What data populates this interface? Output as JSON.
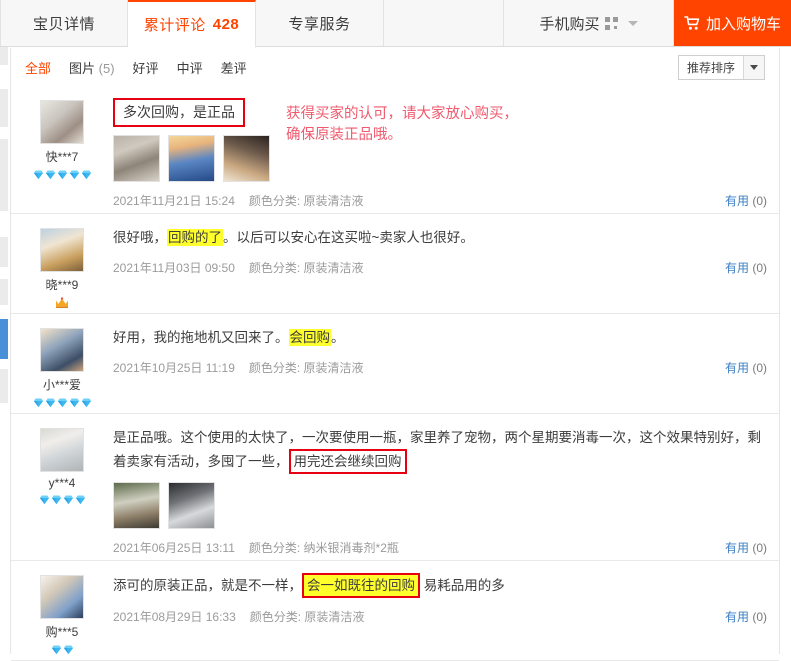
{
  "tabs": [
    {
      "label": "宝贝详情",
      "active": false,
      "count": ""
    },
    {
      "label": "累计评论",
      "active": true,
      "count": "428"
    },
    {
      "label": "专享服务",
      "active": false,
      "count": ""
    }
  ],
  "phone_buy": {
    "label": "手机购买",
    "icon": "qr-code-icon"
  },
  "cart": {
    "label": "加入购物车",
    "icon": "shopping-cart-icon",
    "color": "#ff4400"
  },
  "filters": [
    {
      "label": "全部",
      "count": "",
      "active": true
    },
    {
      "label": "图片",
      "count": "(5)",
      "active": false
    },
    {
      "label": "好评",
      "count": "",
      "active": false
    },
    {
      "label": "中评",
      "count": "",
      "active": false
    },
    {
      "label": "差评",
      "count": "",
      "active": false
    }
  ],
  "sort": {
    "label": "推荐排序",
    "icon": "chevron-down-icon"
  },
  "annotation": "获得买家的认可，请大家放心购买，\n确保原装正品哦。",
  "annotation_color": "#f05a6e",
  "highlight_color": "#ffff2b",
  "box_color": "#e60012",
  "useful_label": "有用",
  "sku_prefix": "颜色分类:",
  "reviews": [
    {
      "user": "快***7",
      "rank_type": "gem",
      "rank_count": 5,
      "boxed_title": "多次回购，是正品",
      "text_parts": [],
      "thumbs": [
        "img-a",
        "img-b",
        "img-c"
      ],
      "date": "2021年11月21日 15:24",
      "sku": "原装清洁液",
      "useful_count": "(0)"
    },
    {
      "user": "晓***9",
      "rank_type": "crown",
      "rank_count": 1,
      "boxed_title": "",
      "text_parts": [
        {
          "t": "很好哦，",
          "style": "plain"
        },
        {
          "t": "回购的了",
          "style": "hl"
        },
        {
          "t": "。以后可以安心在这买啦~卖家人也很好。",
          "style": "plain"
        }
      ],
      "thumbs": [],
      "date": "2021年11月03日 09:50",
      "sku": "原装清洁液",
      "useful_count": "(0)"
    },
    {
      "user": "小***爱",
      "rank_type": "gem",
      "rank_count": 5,
      "boxed_title": "",
      "text_parts": [
        {
          "t": "好用，我的拖地机又回来了。",
          "style": "plain"
        },
        {
          "t": "会回购",
          "style": "hl"
        },
        {
          "t": "。",
          "style": "plain"
        }
      ],
      "thumbs": [],
      "date": "2021年10月25日 11:19",
      "sku": "原装清洁液",
      "useful_count": "(0)"
    },
    {
      "user": "y***4",
      "rank_type": "gem",
      "rank_count": 4,
      "boxed_title": "",
      "text_parts": [
        {
          "t": "是正品哦。这个使用的太快了，一次要使用一瓶，家里养了宠物，两个星期要消毒一次，这个效果特别好，剩着卖家有活动，多囤了一些，",
          "style": "plain"
        },
        {
          "t": "用完还会继续回购",
          "style": "boxed"
        }
      ],
      "thumbs": [
        "img-i",
        "img-h"
      ],
      "date": "2021年06月25日 13:11",
      "sku": "纳米银消毒剂*2瓶",
      "useful_count": "(0)"
    },
    {
      "user": "购***5",
      "rank_type": "gem",
      "rank_count": 2,
      "boxed_title": "",
      "text_parts": [
        {
          "t": "添可的原装正品，就是不一样，",
          "style": "plain"
        },
        {
          "t": "会一如既往的回购",
          "style": "hl-boxed"
        },
        {
          "t": " 易耗品用的多",
          "style": "plain"
        }
      ],
      "thumbs": [],
      "date": "2021年08月29日 16:33",
      "sku": "原装清洁液",
      "useful_count": "(0)"
    }
  ]
}
